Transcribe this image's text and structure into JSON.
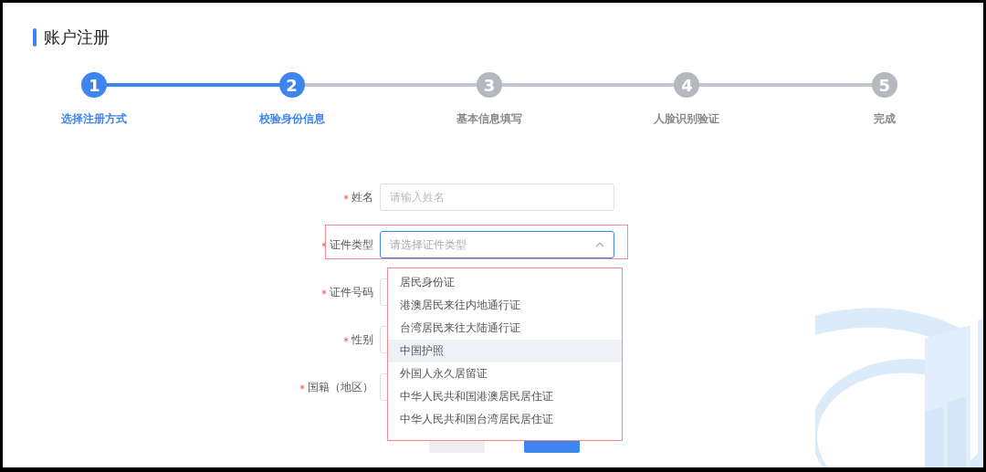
{
  "page_title": "账户注册",
  "steps": [
    {
      "number": "1",
      "label": "选择注册方式",
      "reached": true
    },
    {
      "number": "2",
      "label": "校验身份信息",
      "reached": true
    },
    {
      "number": "3",
      "label": "基本信息填写",
      "reached": false
    },
    {
      "number": "4",
      "label": "人脸识别验证",
      "reached": false
    },
    {
      "number": "5",
      "label": "完成",
      "reached": false
    }
  ],
  "form": {
    "fields": [
      {
        "kind": "input",
        "label": "姓名",
        "required": true,
        "placeholder": "请输入姓名",
        "highlighted": false
      },
      {
        "kind": "select",
        "label": "证件类型",
        "required": true,
        "placeholder": "请选择证件类型",
        "highlighted": true,
        "expanded": true
      },
      {
        "kind": "input",
        "label": "证件号码",
        "required": true,
        "highlighted": false
      },
      {
        "kind": "input",
        "label": "性别",
        "required": true,
        "highlighted": false
      },
      {
        "kind": "input",
        "label": "国籍（地区）",
        "required": true,
        "highlighted": false
      }
    ],
    "dropdown": {
      "highlighted": true,
      "options": [
        {
          "label": "居民身份证",
          "hovered": false
        },
        {
          "label": "港澳居民来往内地通行证",
          "hovered": false
        },
        {
          "label": "台湾居民来往大陆通行证",
          "hovered": false
        },
        {
          "label": "中国护照",
          "hovered": true
        },
        {
          "label": "外国人永久居留证",
          "hovered": false
        },
        {
          "label": "中华人民共和国港澳居民居住证",
          "hovered": false
        },
        {
          "label": "中华人民共和国台湾居民居住证",
          "hovered": false
        }
      ]
    },
    "buttons": [
      {
        "kind": "secondary"
      },
      {
        "kind": "primary"
      }
    ]
  }
}
